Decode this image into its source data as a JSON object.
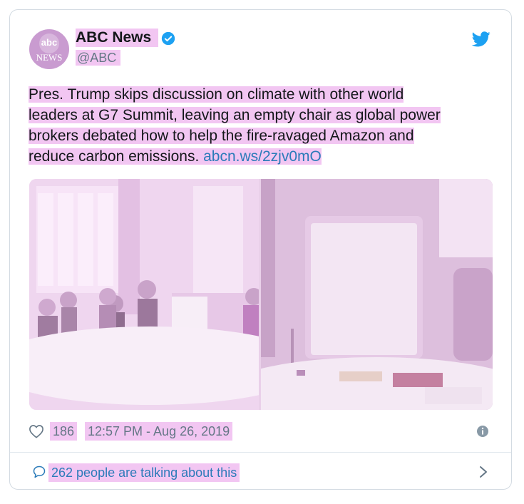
{
  "account": {
    "name": "ABC News",
    "handle": "@ABC",
    "avatar_logo": "abc",
    "avatar_text": "NEWS",
    "verified_icon": "verified-badge-icon"
  },
  "tweet": {
    "lines": [
      "Pres. Trump skips discussion on climate with other world",
      "leaders at G7 Summit, leaving an empty chair as global power",
      "brokers debated how to help the fire-ravaged Amazon and",
      "reduce carbon emissions. "
    ],
    "link": "abcn.ws/2zjv0mO"
  },
  "footer": {
    "likes": "186",
    "timestamp": "12:57 PM - Aug 26, 2019",
    "talking": "262 people are talking about this"
  },
  "colors": {
    "highlight": "#f2c6f2",
    "link": "#2b7bb9",
    "twitter_blue": "#1da1f2",
    "text": "#14171a",
    "muted": "#657786"
  }
}
